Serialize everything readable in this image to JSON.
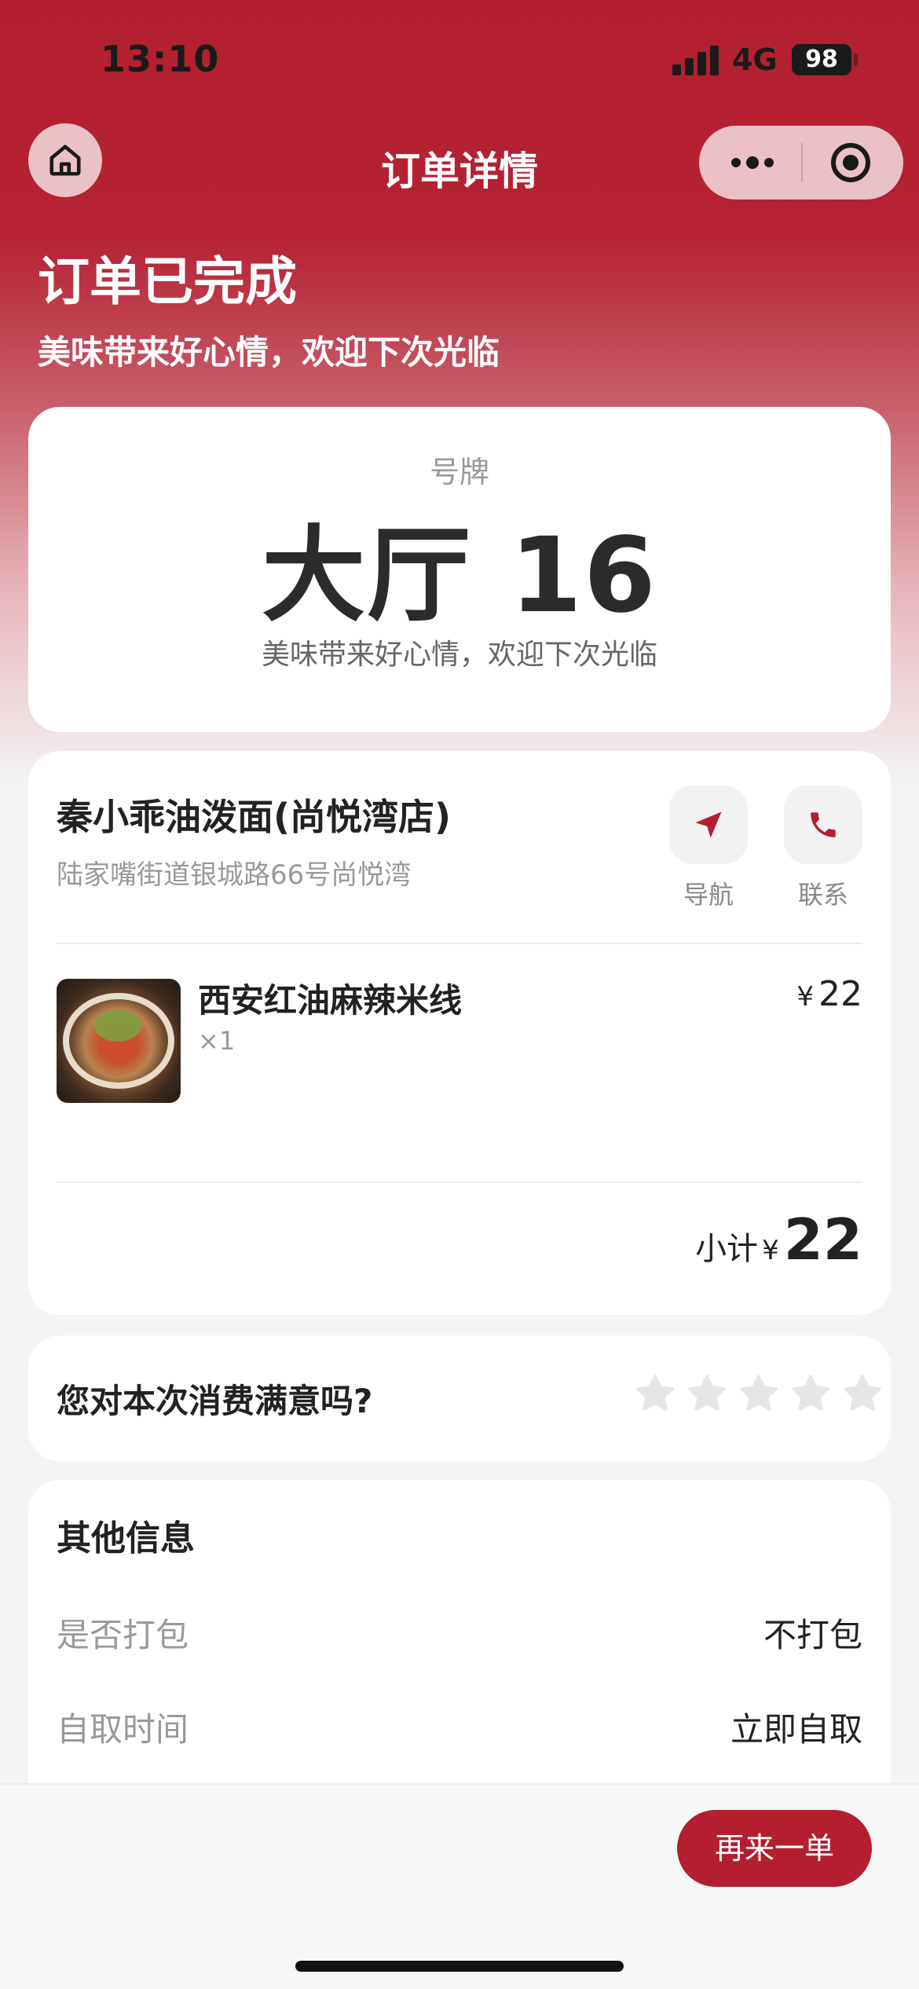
{
  "status_bar": {
    "time": "13:10",
    "network": "4G",
    "battery": "98"
  },
  "nav": {
    "title": "订单详情",
    "home_icon": "home-icon",
    "more_icon": "more-dots-icon",
    "close_icon": "target-circle-icon"
  },
  "header": {
    "title": "订单已完成",
    "subtitle": "美味带来好心情，欢迎下次光临"
  },
  "ticket": {
    "label": "号牌",
    "number": "大厅 16",
    "message": "美味带来好心情，欢迎下次光临"
  },
  "shop": {
    "name": "秦小乖油泼面(尚悦湾店)",
    "address": "陆家嘴街道银城路66号尚悦湾",
    "navigate_label": "导航",
    "contact_label": "联系"
  },
  "items": [
    {
      "name": "西安红油麻辣米线",
      "qty": "×1",
      "currency": "¥",
      "price": "22"
    }
  ],
  "subtotal": {
    "label": "小计",
    "currency": "¥",
    "amount": "22"
  },
  "rating": {
    "question": "您对本次消费满意吗?",
    "stars": 0,
    "max_stars": 5
  },
  "other_info": {
    "title": "其他信息",
    "rows": [
      {
        "key": "是否打包",
        "value": "不打包"
      },
      {
        "key": "自取时间",
        "value": "立即自取"
      }
    ]
  },
  "bottom": {
    "reorder_label": "再来一单"
  },
  "colors": {
    "brand": "#b31f30",
    "page_bg": "#f4f4f4",
    "star_empty": "#e6e6e6"
  }
}
